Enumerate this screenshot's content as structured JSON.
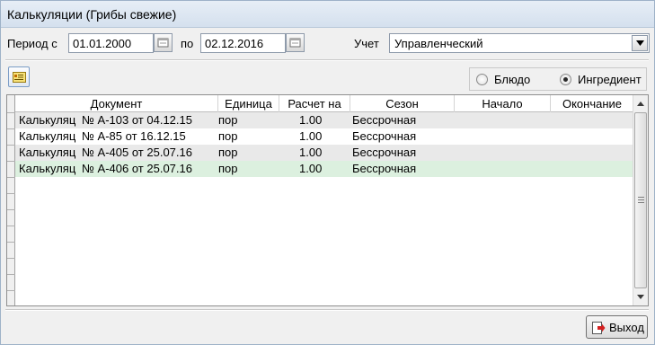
{
  "window": {
    "title": "Калькуляции (Грибы свежие)"
  },
  "filters": {
    "period_label": "Период с",
    "date_from": "01.01.2000",
    "to_label": "по",
    "date_to": "02.12.2016",
    "account_label": "Учет",
    "account_value": "Управленческий"
  },
  "mode": {
    "options": [
      {
        "label": "Блюдо",
        "selected": false
      },
      {
        "label": "Ингредиент",
        "selected": true
      }
    ]
  },
  "table": {
    "columns": [
      "Документ",
      "Единица",
      "Расчет на",
      "Сезон",
      "Начало",
      "Окончание"
    ],
    "rows": [
      {
        "doc_type": "Калькуляц",
        "doc_num": "№ А-103 от 04.12.15",
        "unit": "пор",
        "calc_for": "1.00",
        "season": "Бессрочная",
        "start": "",
        "end": ""
      },
      {
        "doc_type": "Калькуляц",
        "doc_num": "№ А-85 от 16.12.15",
        "unit": "пор",
        "calc_for": "1.00",
        "season": "Бессрочная",
        "start": "",
        "end": ""
      },
      {
        "doc_type": "Калькуляц",
        "doc_num": "№ А-405 от 25.07.16",
        "unit": "пор",
        "calc_for": "1.00",
        "season": "Бессрочная",
        "start": "",
        "end": ""
      },
      {
        "doc_type": "Калькуляц",
        "doc_num": "№ А-406 от 25.07.16",
        "unit": "пор",
        "calc_for": "1.00",
        "season": "Бессрочная",
        "start": "",
        "end": ""
      }
    ],
    "row_colors": [
      "#e9e9e9",
      "#ffffff",
      "#e9e9e9",
      "#dcf0df"
    ]
  },
  "footer": {
    "exit_label": "Выход"
  },
  "icons": {
    "calendar": "calendar-icon",
    "dropdown": "chevron-down-icon",
    "toolbar": "card-icon",
    "exit": "exit-icon"
  }
}
